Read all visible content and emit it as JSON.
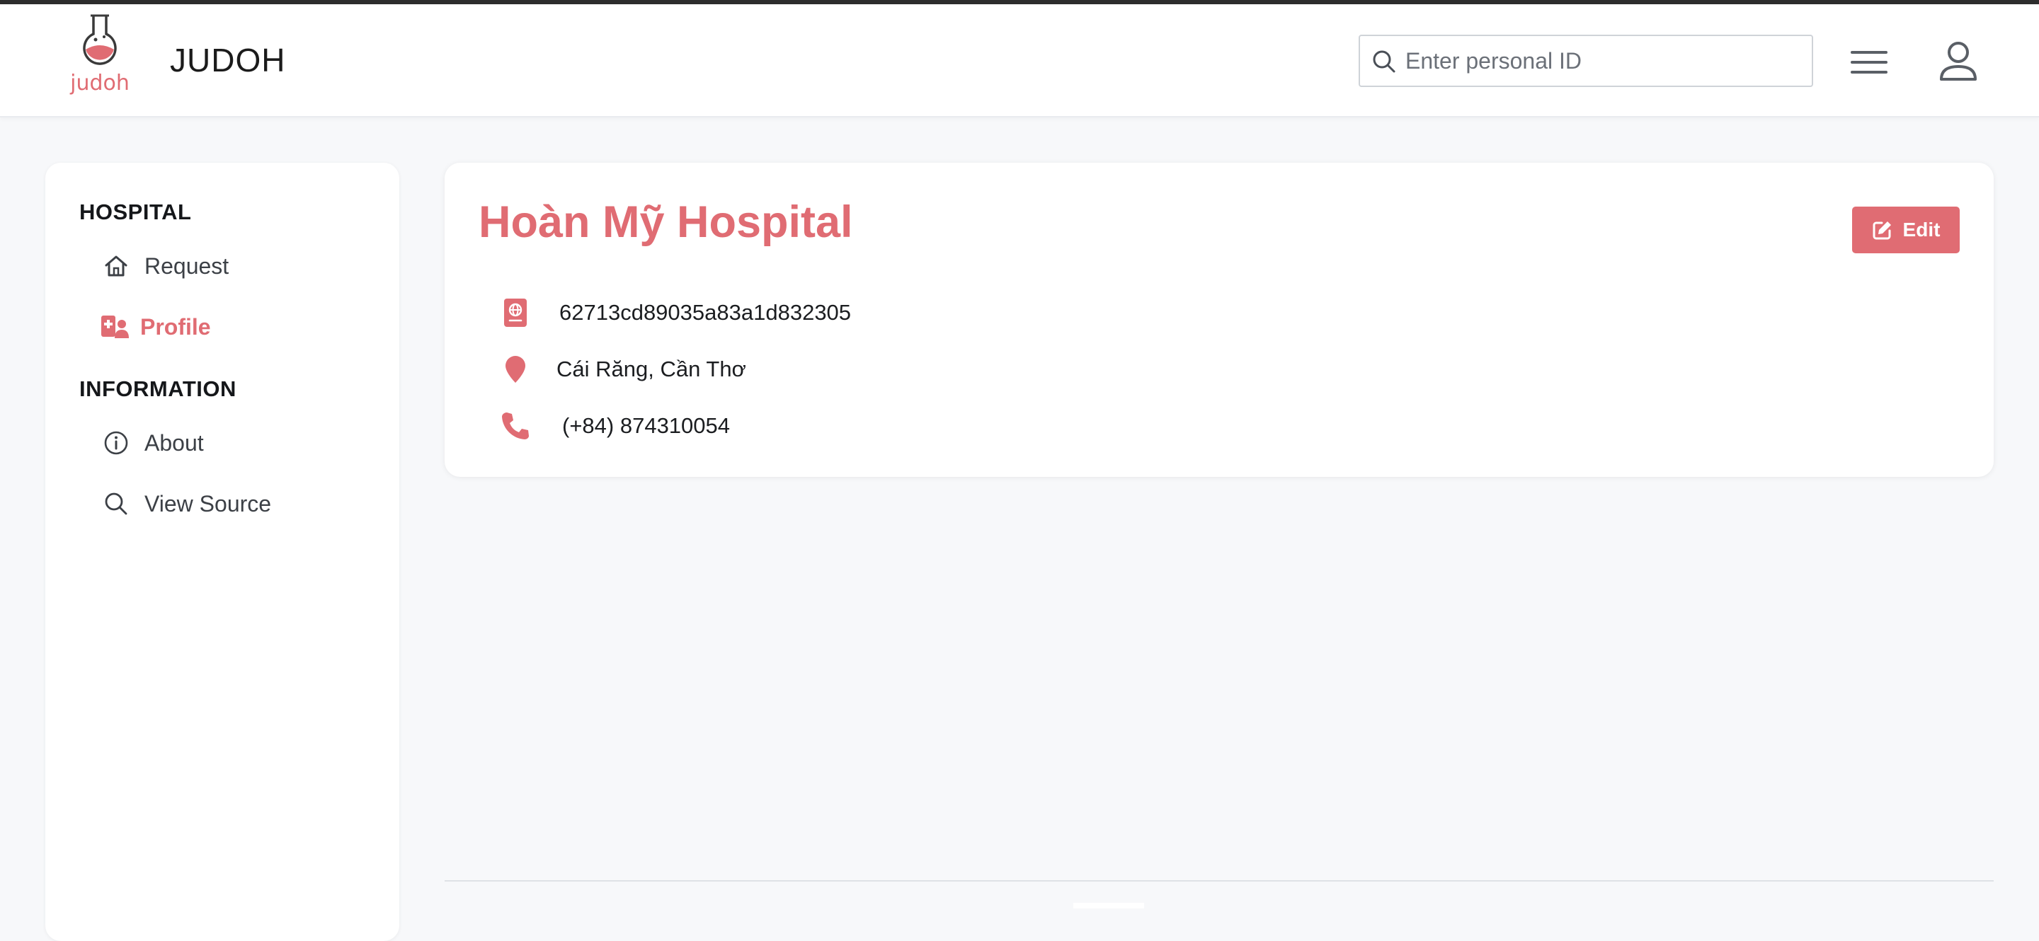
{
  "app": {
    "logo_text": "judoh",
    "title": "JUDOH"
  },
  "search": {
    "placeholder": "Enter personal ID",
    "value": ""
  },
  "sidebar": {
    "sections": [
      {
        "title": "HOSPITAL",
        "items": [
          {
            "label": "Request",
            "icon": "home-icon",
            "active": false
          },
          {
            "label": "Profile",
            "icon": "hospital-user-icon",
            "active": true
          }
        ]
      },
      {
        "title": "INFORMATION",
        "items": [
          {
            "label": "About",
            "icon": "info-circle-icon",
            "active": false
          },
          {
            "label": "View Source",
            "icon": "search-icon",
            "active": false
          }
        ]
      }
    ]
  },
  "profile": {
    "name": "Hoàn Mỹ Hospital",
    "edit_label": "Edit",
    "id": "62713cd89035a83a1d832305",
    "address": "Cái Răng, Cần Thơ",
    "phone": "(+84) 874310054"
  },
  "colors": {
    "accent": "#e06c73",
    "background": "#f7f8fa",
    "card": "#ffffff",
    "text": "#1f2328",
    "muted": "#3c4046"
  }
}
